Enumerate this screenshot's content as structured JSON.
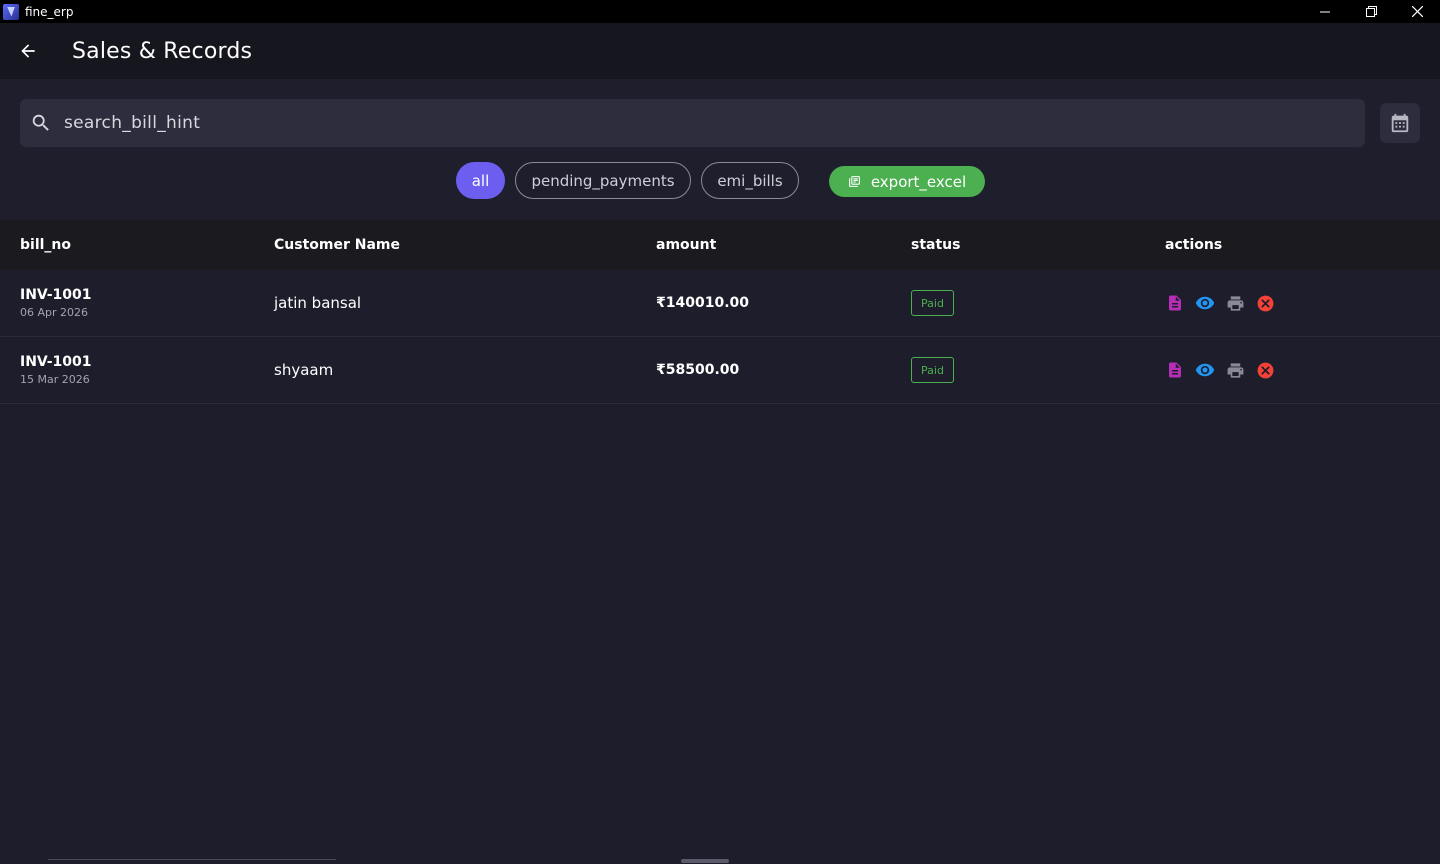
{
  "window": {
    "title": "fine_erp"
  },
  "appbar": {
    "title": "Sales & Records"
  },
  "search": {
    "placeholder": "search_bill_hint"
  },
  "filters": {
    "all": "all",
    "pending": "pending_payments",
    "emi": "emi_bills",
    "export": "export_excel"
  },
  "table": {
    "headers": {
      "bill_no": "bill_no",
      "customer": "Customer Name",
      "amount": "amount",
      "status": "status",
      "actions": "actions"
    },
    "rows": [
      {
        "bill_no": "INV-1001",
        "date": "06 Apr 2026",
        "customer": "jatin bansal",
        "amount": "₹140010.00",
        "status": "Paid"
      },
      {
        "bill_no": "INV-1001",
        "date": "15 Mar 2026",
        "customer": "shyaam",
        "amount": "₹58500.00",
        "status": "Paid"
      }
    ]
  },
  "colors": {
    "accent": "#6c5ff0",
    "export_green": "#4caf50",
    "paid_green": "#4caf50",
    "invoice_icon": "#b52eb5",
    "view_icon": "#2196f3",
    "print_icon": "#8a8a96",
    "cancel_icon": "#f44336"
  },
  "icons": {
    "back": "arrow-left-icon",
    "search": "search-icon",
    "calendar": "calendar-icon",
    "export": "spreadsheet-icon",
    "invoice": "document-icon",
    "view": "eye-icon",
    "print": "printer-icon",
    "cancel": "cancel-circle-icon"
  }
}
